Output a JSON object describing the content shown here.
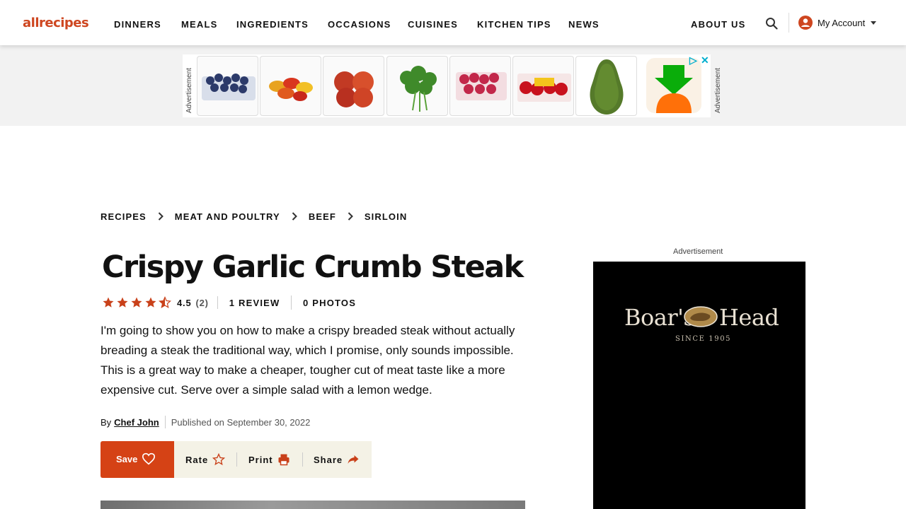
{
  "header": {
    "logo_text": "allrecipes",
    "nav": [
      "DINNERS",
      "MEALS",
      "INGREDIENTS",
      "OCCASIONS",
      "CUISINES",
      "KITCHEN TIPS",
      "NEWS",
      "ABOUT US"
    ],
    "account_label": "My Account",
    "search_icon": "search-icon",
    "account_icon": "user-circle-icon",
    "brand_color": "#ce4620"
  },
  "top_ad": {
    "label": "Advertisement",
    "products": [
      "blueberries",
      "mini sweet peppers",
      "apples",
      "parsley",
      "raspberries",
      "strawberries",
      "avocado"
    ],
    "brand": "instacart"
  },
  "breadcrumb": [
    "RECIPES",
    "MEAT AND POULTRY",
    "BEEF",
    "SIRLOIN"
  ],
  "recipe": {
    "title": "Crispy Garlic Crumb Steak",
    "rating_value": "4.5",
    "rating_count": "(2)",
    "rating_stars": 4.5,
    "reviews": "1 REVIEW",
    "photos": "0 PHOTOS",
    "description_lines": [
      "I'm going to show you on how to make a crispy breaded steak without actually",
      "breading a steak the traditional way, which I promise, only sounds impossible.",
      "This is a great way to make a cheaper, tougher cut of meat taste like a more",
      "expensive cut. Serve over a simple salad with a lemon wedge."
    ],
    "by": "By",
    "author": "Chef John",
    "published": "Published on September 30, 2022"
  },
  "actions": {
    "save": "Save",
    "rate": "Rate",
    "print": "Print",
    "share": "Share"
  },
  "side_ad": {
    "label": "Advertisement",
    "brand_left": "Boar's",
    "brand_right": "Head",
    "since": "SINCE 1905"
  }
}
